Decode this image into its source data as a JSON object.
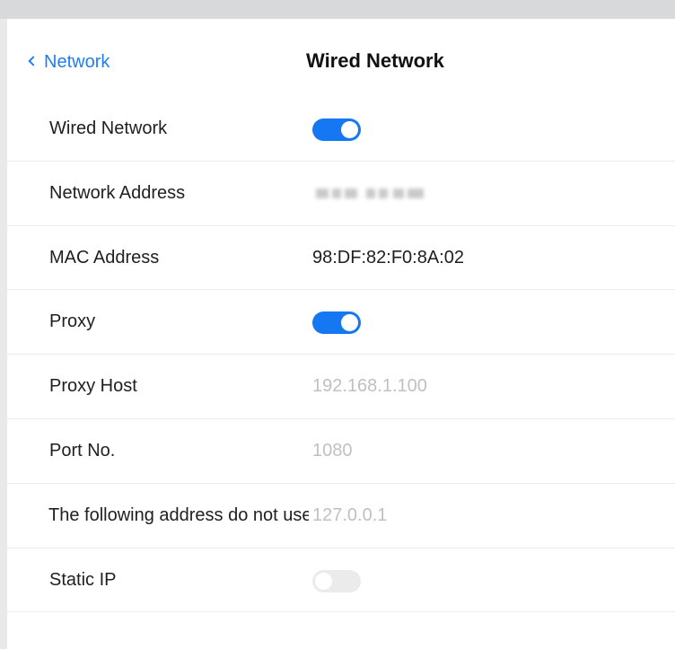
{
  "header": {
    "back_label": "Network",
    "title": "Wired Network"
  },
  "rows": [
    {
      "label": "Wired Network",
      "type": "toggle",
      "on": true
    },
    {
      "label": "Network Address",
      "type": "redacted"
    },
    {
      "label": "MAC Address",
      "type": "text",
      "value": "98:DF:82:F0:8A:02"
    },
    {
      "label": "Proxy",
      "type": "toggle",
      "on": true
    },
    {
      "label": "Proxy Host",
      "type": "input",
      "value": "192.168.1.100"
    },
    {
      "label": "Port No.",
      "type": "input",
      "value": "1080"
    },
    {
      "label": "The following address do not use proxy",
      "type": "input",
      "value": "127.0.0.1"
    },
    {
      "label": "Static IP",
      "type": "toggle",
      "on": false
    }
  ],
  "colors": {
    "accent": "#1677f2",
    "back_link": "#1f7ef2",
    "muted_text": "#c0c0c0"
  }
}
